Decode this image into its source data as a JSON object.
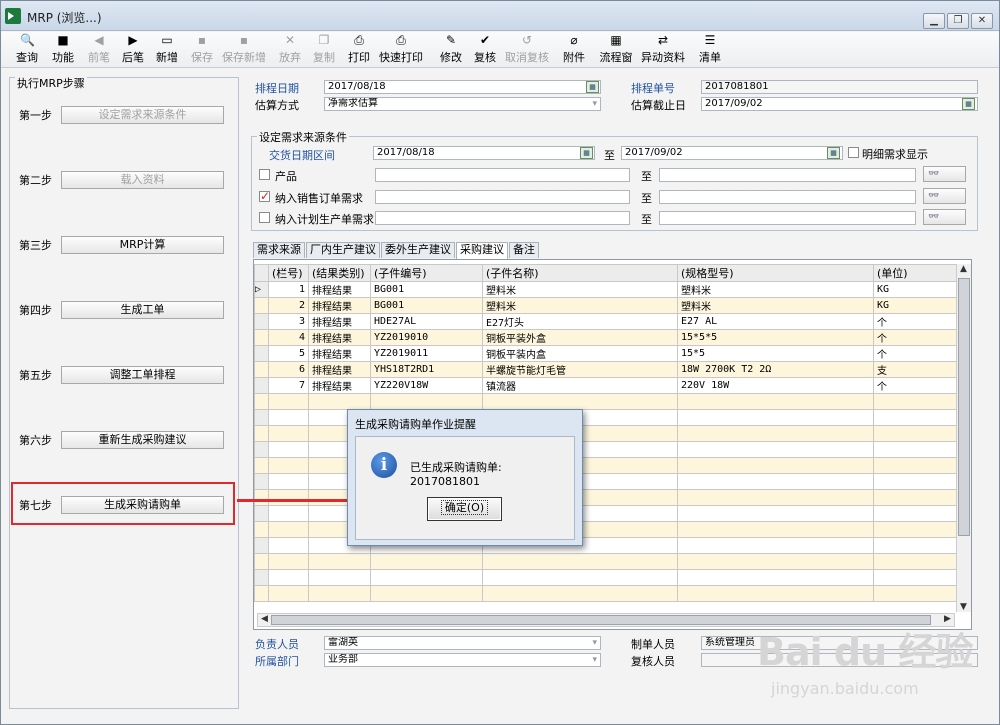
{
  "window": {
    "title": "MRP (浏览...)",
    "min": "▁",
    "max": "❐",
    "close": "✕"
  },
  "toolbar": [
    {
      "label": "查询",
      "icon": "🔍",
      "enabled": true
    },
    {
      "label": "功能",
      "icon": "■",
      "enabled": true
    },
    {
      "label": "前笔",
      "icon": "◀",
      "enabled": false
    },
    {
      "label": "后笔",
      "icon": "▶",
      "enabled": true
    },
    {
      "label": "新增",
      "icon": "▭",
      "enabled": true
    },
    {
      "label": "保存",
      "icon": "▪",
      "enabled": false
    },
    {
      "label": "保存新增",
      "icon": "▪",
      "enabled": false
    },
    {
      "label": "放弃",
      "icon": "✕",
      "enabled": false
    },
    {
      "label": "复制",
      "icon": "❐",
      "enabled": false
    },
    {
      "label": "打印",
      "icon": "⎙",
      "enabled": true
    },
    {
      "label": "快速打印",
      "icon": "⎙",
      "enabled": true
    },
    {
      "label": "修改",
      "icon": "✎",
      "enabled": true
    },
    {
      "label": "复核",
      "icon": "✔",
      "enabled": true
    },
    {
      "label": "取消复核",
      "icon": "↺",
      "enabled": false
    },
    {
      "label": "附件",
      "icon": "⌀",
      "enabled": true
    },
    {
      "label": "流程窗",
      "icon": "▦",
      "enabled": true
    },
    {
      "label": "异动资料",
      "icon": "⇄",
      "enabled": true
    },
    {
      "label": "清单",
      "icon": "☰",
      "enabled": true
    }
  ],
  "steps": {
    "title": "执行MRP步骤",
    "items": [
      {
        "label": "第一步",
        "button": "设定需求来源条件",
        "enabled": false
      },
      {
        "label": "第二步",
        "button": "载入资料",
        "enabled": false
      },
      {
        "label": "第三步",
        "button": "MRP计算",
        "enabled": true
      },
      {
        "label": "第四步",
        "button": "生成工单",
        "enabled": true
      },
      {
        "label": "第五步",
        "button": "调整工单排程",
        "enabled": true
      },
      {
        "label": "第六步",
        "button": "重新生成采购建议",
        "enabled": true
      },
      {
        "label": "第七步",
        "button": "生成采购请购单",
        "enabled": true
      }
    ]
  },
  "header": {
    "schedule_date_label": "排程日期",
    "schedule_date": "2017/08/18",
    "schedule_no_label": "排程单号",
    "schedule_no": "2017081801",
    "method_label": "估算方式",
    "method": "净需求估算",
    "deadline_label": "估算截止日",
    "deadline": "2017/09/02"
  },
  "source": {
    "title": "设定需求来源条件",
    "date_range_label": "交货日期区间",
    "date_from": "2017/08/18",
    "to": "至",
    "date_to": "2017/09/02",
    "detail_label": "明细需求显示",
    "rows": [
      {
        "label": "产品",
        "checked": false,
        "to": "至"
      },
      {
        "label": "纳入销售订单需求",
        "checked": true,
        "to": "至"
      },
      {
        "label": "纳入计划生产单需求",
        "checked": false,
        "to": "至"
      }
    ],
    "binoc": "👓"
  },
  "tabs": [
    "需求来源",
    "厂内生产建议",
    "委外生产建议",
    "采购建议",
    "备注"
  ],
  "grid": {
    "columns": [
      "(栏号)",
      "(结果类别)",
      "(子件编号)",
      "(子件名称)",
      "(规格型号)",
      "(单位)"
    ],
    "rows": [
      {
        "no": "1",
        "type": "排程结果",
        "code": "BG001",
        "name": "塑料米",
        "spec": "塑料米",
        "unit": "KG"
      },
      {
        "no": "2",
        "type": "排程结果",
        "code": "BG001",
        "name": "塑料米",
        "spec": "塑料米",
        "unit": "KG"
      },
      {
        "no": "3",
        "type": "排程结果",
        "code": "HDE27AL",
        "name": "E27灯头",
        "spec": "E27 AL",
        "unit": "个"
      },
      {
        "no": "4",
        "type": "排程结果",
        "code": "YZ2019010",
        "name": "铜板平装外盒",
        "spec": "15*5*5",
        "unit": "个"
      },
      {
        "no": "5",
        "type": "排程结果",
        "code": "YZ2019011",
        "name": "铜板平装内盒",
        "spec": "15*5",
        "unit": "个"
      },
      {
        "no": "6",
        "type": "排程结果",
        "code": "YHS18T2RD1",
        "name": "半螺旋节能灯毛管",
        "spec": "18W 2700K T2 2Ω",
        "unit": "支"
      },
      {
        "no": "7",
        "type": "排程结果",
        "code": "YZ220V18W",
        "name": "镇流器",
        "spec": "220V 18W",
        "unit": "个"
      }
    ],
    "empty_rows": 13
  },
  "footer": {
    "owner_label": "负责人员",
    "owner": "雷湖英",
    "dept_label": "所属部门",
    "dept": "业务部",
    "maker_label": "制单人员",
    "maker": "系统管理员",
    "reviewer_label": "复核人员",
    "reviewer": ""
  },
  "dialog": {
    "title": "生成采购请购单作业提醒",
    "message": "已生成采购请购单: 2017081801",
    "ok": "确定(O)"
  },
  "watermark": {
    "brand": "Bai du 经验",
    "url": "jingyan.baidu.com"
  },
  "colors": {
    "highlight": "#e0282e",
    "accent_blue": "#2353a3",
    "row_alt": "#fdf6dc"
  }
}
